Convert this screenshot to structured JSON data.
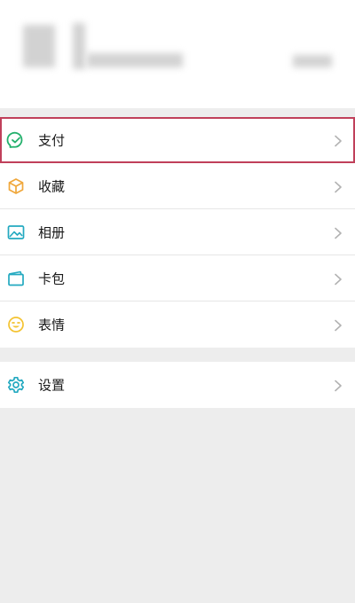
{
  "menu_items": [
    {
      "label": "支付"
    },
    {
      "label": "收藏"
    },
    {
      "label": "相册"
    },
    {
      "label": "卡包"
    },
    {
      "label": "表情"
    },
    {
      "label": "设置"
    }
  ],
  "colors": {
    "accent_green": "#23b06c",
    "highlight_border": "#c0405a",
    "favorites_orange": "#f0a73b",
    "sticker_yellow": "#f4c331",
    "chevron_gray": "#b2b2b2"
  }
}
